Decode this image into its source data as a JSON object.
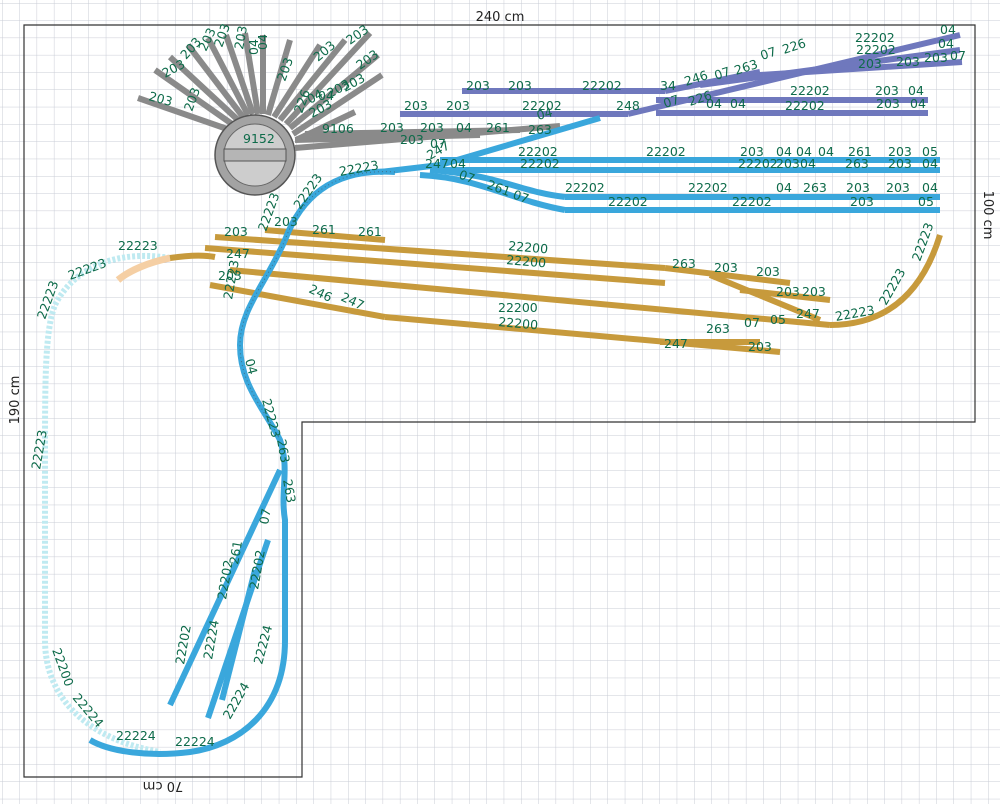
{
  "dimensions": {
    "top_width": "240 cm",
    "left_height": "190 cm",
    "right_height": "100 cm",
    "bottom_width": "70 cm"
  },
  "colors": {
    "grid": "#c9ccd6",
    "outline": "#333333",
    "label": "#0e6b4a",
    "turntable": "#a3a3a3",
    "yard_grey": "#8a8a8a",
    "blue_main": "#3aa7dc",
    "violet_yard": "#6f78bd",
    "brown_yard": "#c79a3c",
    "ghost_track": "#bfeaf1",
    "orange_ghost": "#f5cfa4"
  },
  "labels": {
    "fan": [
      "203",
      "203",
      "203",
      "203",
      "203",
      "203",
      "04",
      "04",
      "203",
      "203",
      "203",
      "203",
      "203",
      "203",
      "203",
      "226",
      "04",
      "04",
      "203"
    ],
    "turntable": "9152",
    "grey_yard": [
      "9106",
      "203",
      "203",
      "203",
      "04",
      "261",
      "263",
      "04",
      "07"
    ],
    "violet_top": [
      "203",
      "203",
      "22202",
      "34",
      "246",
      "07",
      "263",
      "07",
      "226",
      "22202",
      "04",
      "22202",
      "04",
      "203",
      "203",
      "203",
      "07"
    ],
    "violet_mid": [
      "203",
      "203",
      "22202",
      "248",
      "07",
      "226",
      "04",
      "04",
      "22202",
      "22202",
      "203",
      "04",
      "203",
      "04"
    ],
    "blue_yard": [
      "247",
      "22202",
      "22202",
      "22202",
      "203",
      "04",
      "04",
      "04",
      "261",
      "203",
      "05",
      "22202",
      "203",
      "04",
      "263",
      "203",
      "04",
      "22202",
      "22202",
      "04",
      "263",
      "203",
      "203",
      "04",
      "22202",
      "22202",
      "203",
      "05",
      "247",
      "07",
      "261",
      "07",
      "04"
    ],
    "brown": [
      "203",
      "203",
      "261",
      "261",
      "247",
      "203",
      "246",
      "247",
      "22200",
      "22200",
      "22200",
      "22200",
      "263",
      "203",
      "203",
      "203",
      "203",
      "263",
      "07",
      "05",
      "247",
      "22223",
      "203",
      "247",
      "22223",
      "22223"
    ],
    "helix_blue": [
      "22223",
      "22223",
      "22223",
      "22223",
      "04",
      "22223",
      "263",
      "263",
      "07",
      "261",
      "22202",
      "22202",
      "22202",
      "22224",
      "22224",
      "22224"
    ],
    "ghost_loop": [
      "22223",
      "22223",
      "22223",
      "22223",
      "22200",
      "22224",
      "22224",
      "22224"
    ]
  }
}
